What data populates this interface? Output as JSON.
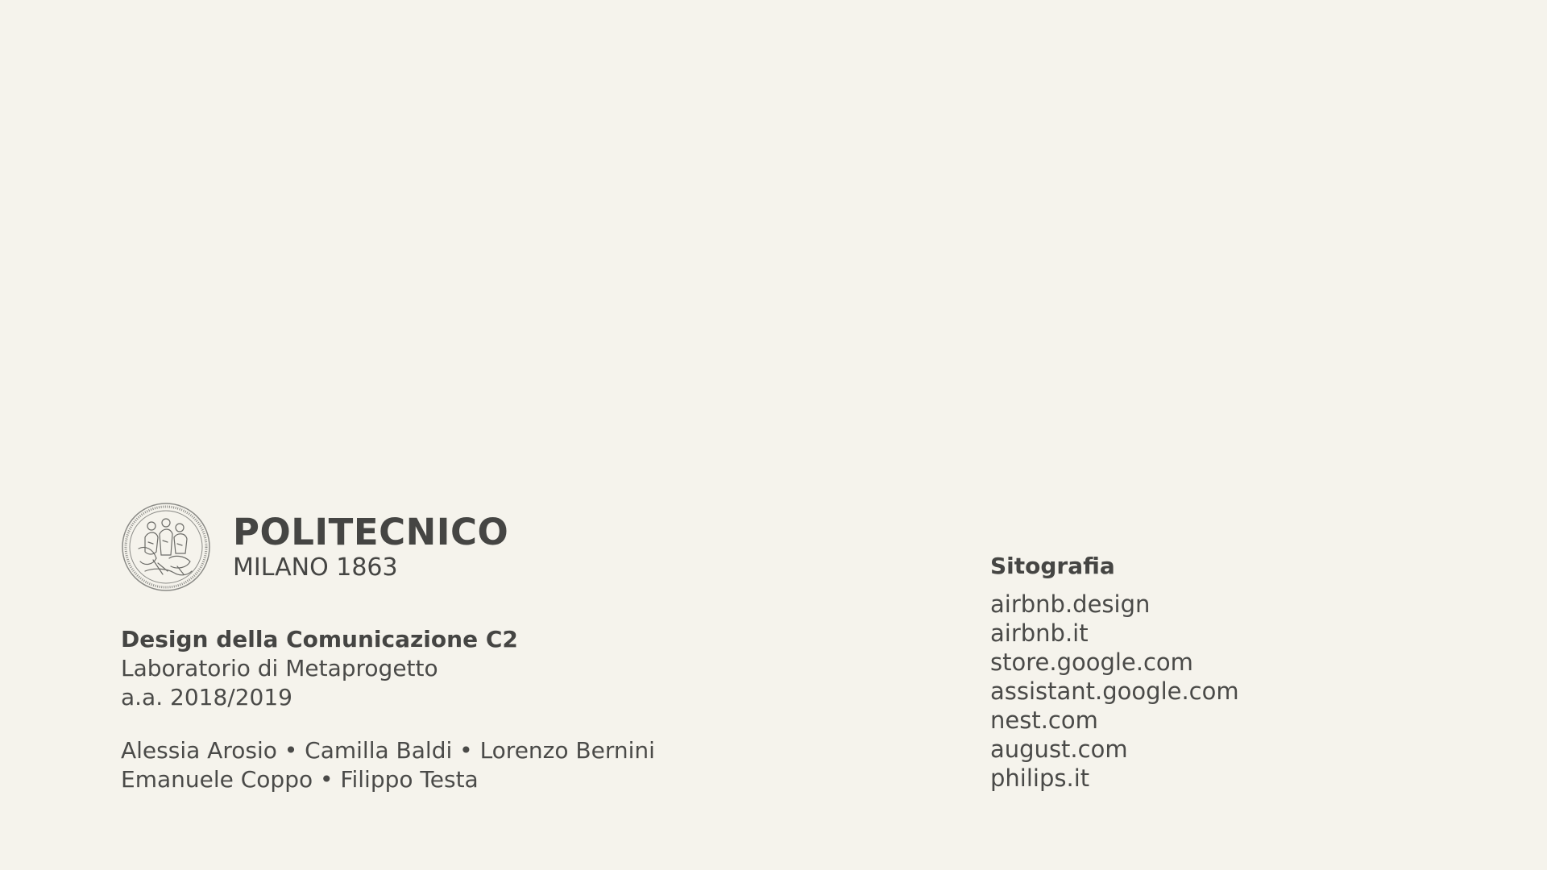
{
  "logo": {
    "name": "POLITECNICO",
    "subtitle": "MILANO 1863"
  },
  "course": {
    "title": "Design della Comunicazione C2",
    "lab": "Laboratorio di Metaprogetto",
    "year": "a.a. 2018/2019"
  },
  "authors": {
    "line1": "Alessia Arosio • Camilla Baldi • Lorenzo Bernini",
    "line2": "Emanuele Coppo • Filippo Testa"
  },
  "sitografia": {
    "title": "Sitografia",
    "items": [
      "airbnb.design",
      "airbnb.it",
      "store.google.com",
      "assistant.google.com",
      "nest.com",
      "august.com",
      "philips.it"
    ]
  },
  "colors": {
    "background": "#f5f3ec",
    "text": "#4a4a48"
  }
}
